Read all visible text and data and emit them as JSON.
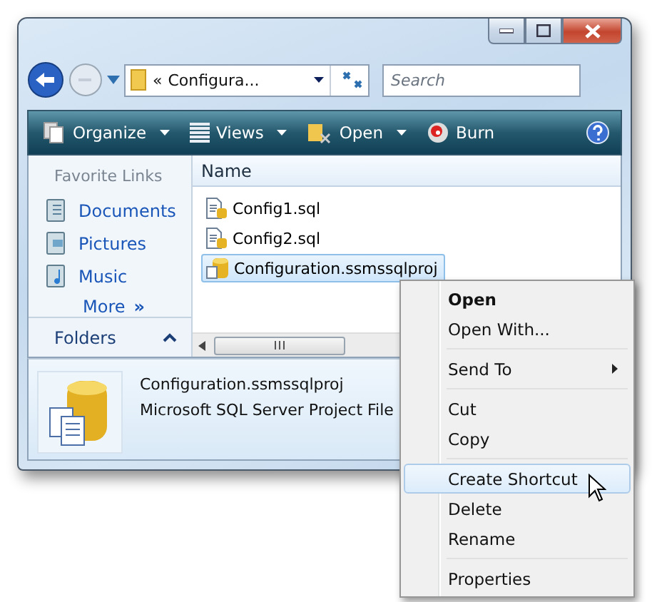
{
  "address": {
    "prefix": "«",
    "path": "Configura..."
  },
  "search": {
    "placeholder": "Search"
  },
  "toolbar": [
    {
      "label": "Organize",
      "dropdown": true
    },
    {
      "label": "Views",
      "dropdown": true
    },
    {
      "label": "Open",
      "dropdown": true
    },
    {
      "label": "Burn",
      "dropdown": false
    }
  ],
  "favorite_links": {
    "title": "Favorite Links",
    "items": [
      {
        "label": "Documents"
      },
      {
        "label": "Pictures"
      },
      {
        "label": "Music"
      }
    ],
    "more": {
      "label": "More",
      "glyph": "»"
    }
  },
  "folders": {
    "label": "Folders",
    "expanded": false
  },
  "columns": [
    "Name"
  ],
  "files": [
    {
      "name": "Config1.sql",
      "kind": "sql",
      "selected": false
    },
    {
      "name": "Config2.sql",
      "kind": "sql",
      "selected": false
    },
    {
      "name": "Configuration.ssmssqlproj",
      "kind": "project",
      "selected": true
    }
  ],
  "details": {
    "name": "Configuration.ssmssqlproj",
    "type": "Microsoft SQL Server Project File"
  },
  "context_menu": [
    {
      "kind": "item",
      "label": "Open",
      "bold": true,
      "submenu": false,
      "selected": false
    },
    {
      "kind": "item",
      "label": "Open With...",
      "bold": false,
      "submenu": false,
      "selected": false
    },
    {
      "kind": "separator"
    },
    {
      "kind": "item",
      "label": "Send To",
      "bold": false,
      "submenu": true,
      "selected": false
    },
    {
      "kind": "separator"
    },
    {
      "kind": "item",
      "label": "Cut",
      "bold": false,
      "submenu": false,
      "selected": false
    },
    {
      "kind": "item",
      "label": "Copy",
      "bold": false,
      "submenu": false,
      "selected": false
    },
    {
      "kind": "separator"
    },
    {
      "kind": "item",
      "label": "Create Shortcut",
      "bold": false,
      "submenu": false,
      "selected": true
    },
    {
      "kind": "item",
      "label": "Delete",
      "bold": false,
      "submenu": false,
      "selected": false
    },
    {
      "kind": "item",
      "label": "Rename",
      "bold": false,
      "submenu": false,
      "selected": false
    },
    {
      "kind": "separator"
    },
    {
      "kind": "item",
      "label": "Properties",
      "bold": false,
      "submenu": false,
      "selected": false
    }
  ]
}
